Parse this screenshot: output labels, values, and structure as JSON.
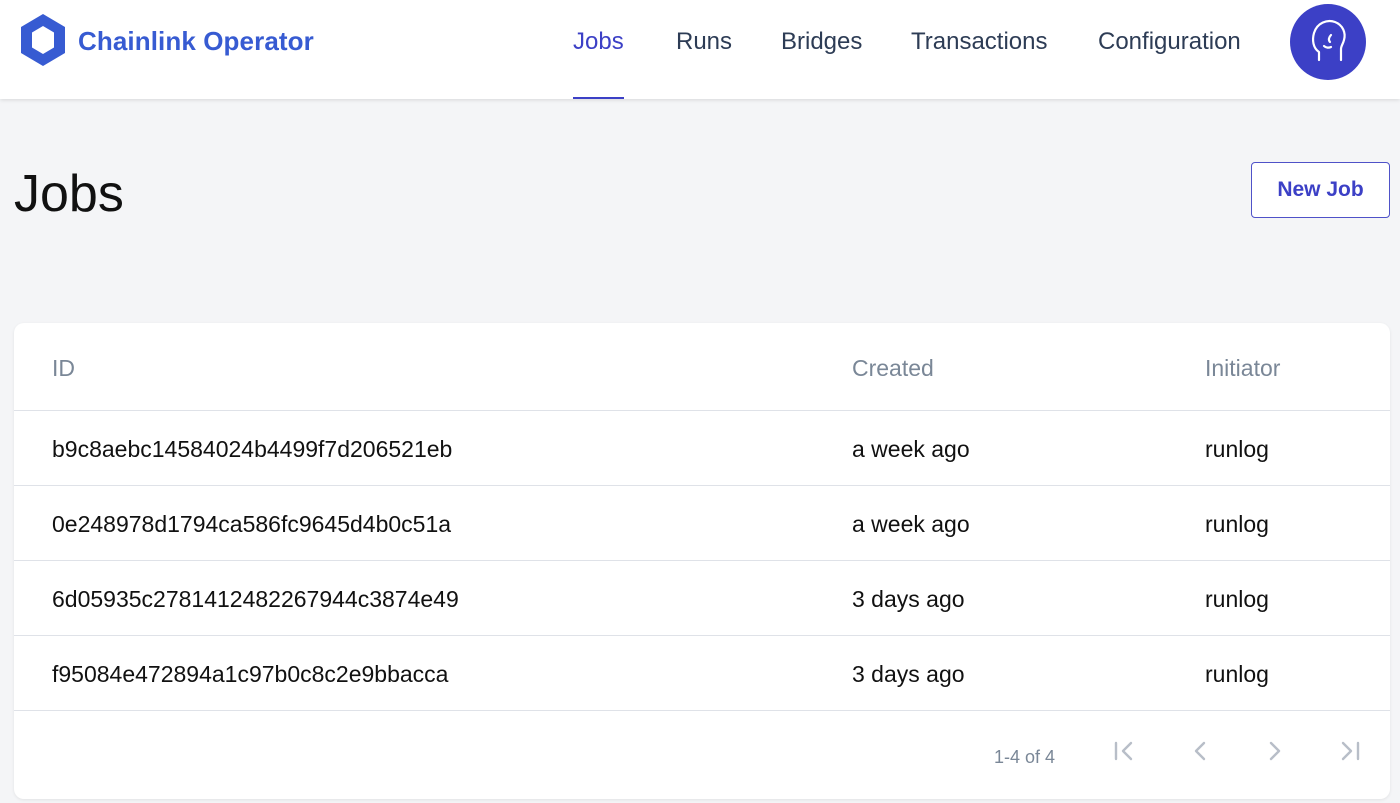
{
  "header": {
    "brand_name": "Chainlink Operator",
    "brand_color": "#375bd2",
    "accent_color": "#3c40c6",
    "nav": [
      {
        "label": "Jobs",
        "active": true
      },
      {
        "label": "Runs",
        "active": false
      },
      {
        "label": "Bridges",
        "active": false
      },
      {
        "label": "Transactions",
        "active": false
      },
      {
        "label": "Configuration",
        "active": false
      }
    ],
    "avatar_icon": "user-head-icon"
  },
  "main": {
    "title": "Jobs",
    "new_job_label": "New Job"
  },
  "table": {
    "columns": [
      "ID",
      "Created",
      "Initiator"
    ],
    "rows": [
      {
        "id": "b9c8aebc14584024b4499f7d206521eb",
        "created": "a week ago",
        "initiator": "runlog"
      },
      {
        "id": "0e248978d1794ca586fc9645d4b0c51a",
        "created": "a week ago",
        "initiator": "runlog"
      },
      {
        "id": "6d05935c2781412482267944c3874e49",
        "created": "3 days ago",
        "initiator": "runlog"
      },
      {
        "id": "f95084e472894a1c97b0c8c2e9bbacca",
        "created": "3 days ago",
        "initiator": "runlog"
      }
    ],
    "pagination": {
      "label": "1-4 of 4",
      "icons": [
        "first-page-icon",
        "previous-page-icon",
        "next-page-icon",
        "last-page-icon"
      ]
    }
  }
}
